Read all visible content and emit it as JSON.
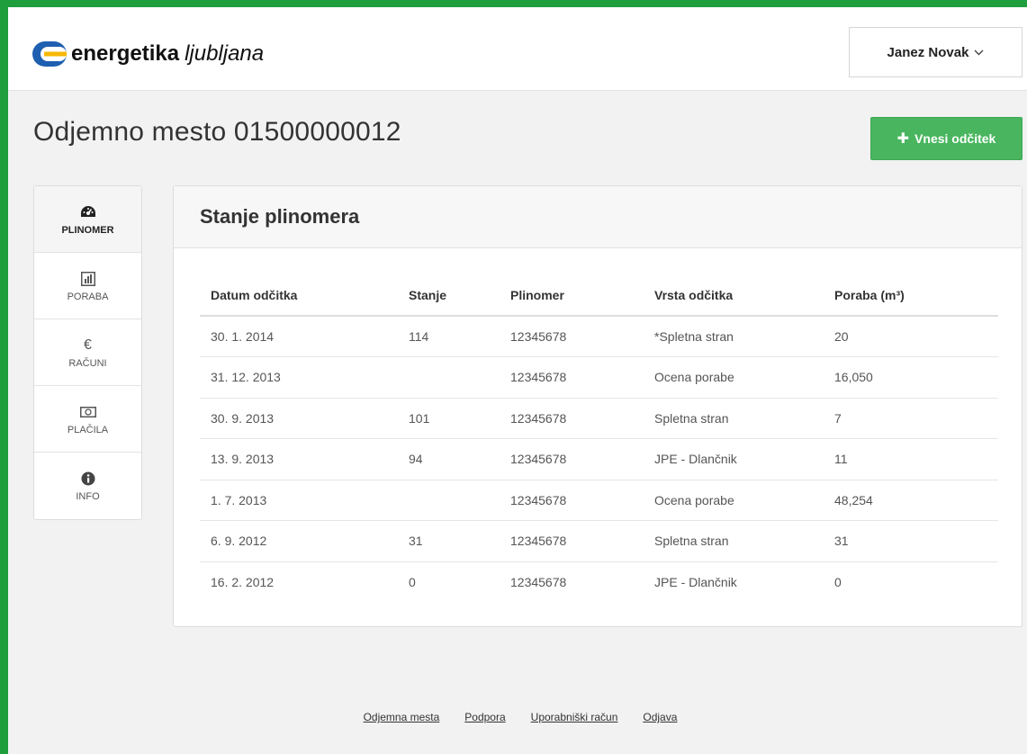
{
  "brand": {
    "name_bold": "energetika",
    "name_italic": "ljubljana",
    "colors": {
      "blue": "#1f5fb1",
      "yellow": "#f7b800",
      "green": "#1e9e3c"
    }
  },
  "user_menu": {
    "name": "Janez Novak",
    "chevron_icon": "chevron-down-icon"
  },
  "page": {
    "title": "Odjemno mesto 01500000012",
    "add_button": {
      "label": "Vnesi odčitek",
      "icon": "plus-icon",
      "color": "#49b65f"
    }
  },
  "sidebar": {
    "items": [
      {
        "label": "PLINOMER",
        "icon": "dashboard-icon",
        "active": true
      },
      {
        "label": "PORABA",
        "icon": "bar-chart-icon",
        "active": false
      },
      {
        "label": "RAČUNI",
        "icon": "euro-icon",
        "active": false
      },
      {
        "label": "PLAČILA",
        "icon": "money-icon",
        "active": false
      },
      {
        "label": "INFO",
        "icon": "info-icon",
        "active": false
      }
    ]
  },
  "panel": {
    "title": "Stanje plinomera",
    "table": {
      "headers": [
        "Datum odčitka",
        "Stanje",
        "Plinomer",
        "Vrsta odčitka",
        "Poraba (m³)"
      ],
      "rows": [
        [
          "30. 1. 2014",
          "114",
          "12345678",
          "*Spletna stran",
          "20"
        ],
        [
          "31. 12. 2013",
          "",
          "12345678",
          "Ocena porabe",
          "16,050"
        ],
        [
          "30. 9. 2013",
          "101",
          "12345678",
          "Spletna stran",
          "7"
        ],
        [
          "13. 9. 2013",
          "94",
          "12345678",
          "JPE - Dlančnik",
          "11"
        ],
        [
          "1. 7. 2013",
          "",
          "12345678",
          "Ocena porabe",
          "48,254"
        ],
        [
          "6. 9. 2012",
          "31",
          "12345678",
          "Spletna stran",
          "31"
        ],
        [
          "16. 2. 2012",
          "0",
          "12345678",
          "JPE - Dlančnik",
          "0"
        ]
      ]
    }
  },
  "footer": {
    "links": [
      "Odjemna mesta",
      "Podpora",
      "Uporabniški račun",
      "Odjava"
    ]
  }
}
